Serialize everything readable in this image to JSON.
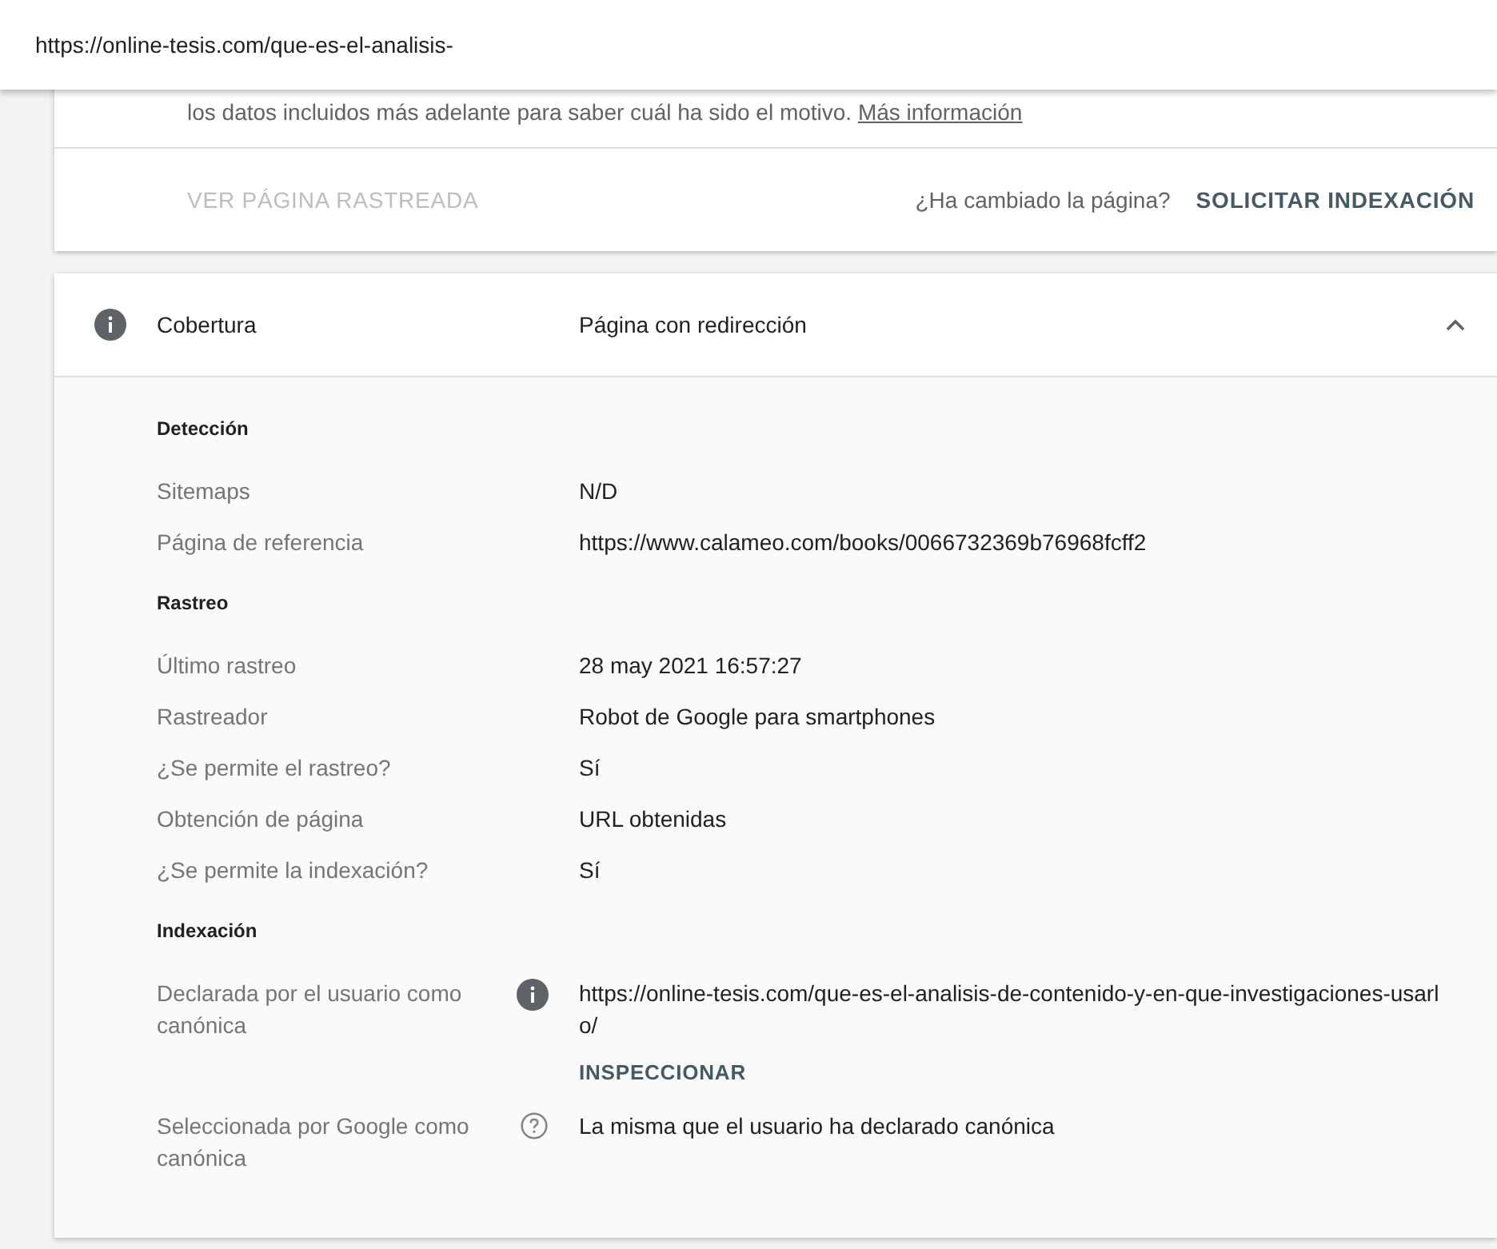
{
  "address_bar": {
    "url": "https://online-tesis.com/que-es-el-analisis-"
  },
  "notice": {
    "text": "los datos incluidos más adelante para saber cuál ha sido el motivo.",
    "link": "Más información"
  },
  "actions": {
    "view_crawled": {
      "label": "VER PÁGINA RASTREADA",
      "disabled": true
    },
    "prompt": "¿Ha cambiado la página?",
    "request_indexing": {
      "label": "SOLICITAR INDEXACIÓN",
      "disabled": false
    }
  },
  "coverage": {
    "title": "Cobertura",
    "status": "Página con redirección",
    "expanded": true,
    "sections": [
      {
        "heading": "Detección",
        "rows": [
          {
            "label": "Sitemaps",
            "value": "N/D"
          },
          {
            "label": "Página de referencia",
            "value": "https://www.calameo.com/books/0066732369b76968fcff2"
          }
        ]
      },
      {
        "heading": "Rastreo",
        "rows": [
          {
            "label": "Último rastreo",
            "value": "28 may 2021 16:57:27"
          },
          {
            "label": "Rastreador",
            "value": "Robot de Google para smartphones"
          },
          {
            "label": "¿Se permite el rastreo?",
            "value": "Sí"
          },
          {
            "label": "Obtención de página",
            "value": "URL obtenidas"
          },
          {
            "label": "¿Se permite la indexación?",
            "value": "Sí"
          }
        ]
      },
      {
        "heading": "Indexación",
        "rows": [
          {
            "label": "Declarada por el usuario como canónica",
            "kind": "info",
            "value": "https://online-tesis.com/que-es-el-analisis-de-contenido-y-en-que-investigaciones-usarlo/",
            "action": "INSPECCIONAR"
          },
          {
            "label": "Seleccionada por Google como canónica",
            "kind": "help",
            "value": "La misma que el usuario ha declarado canónica"
          }
        ]
      }
    ]
  }
}
